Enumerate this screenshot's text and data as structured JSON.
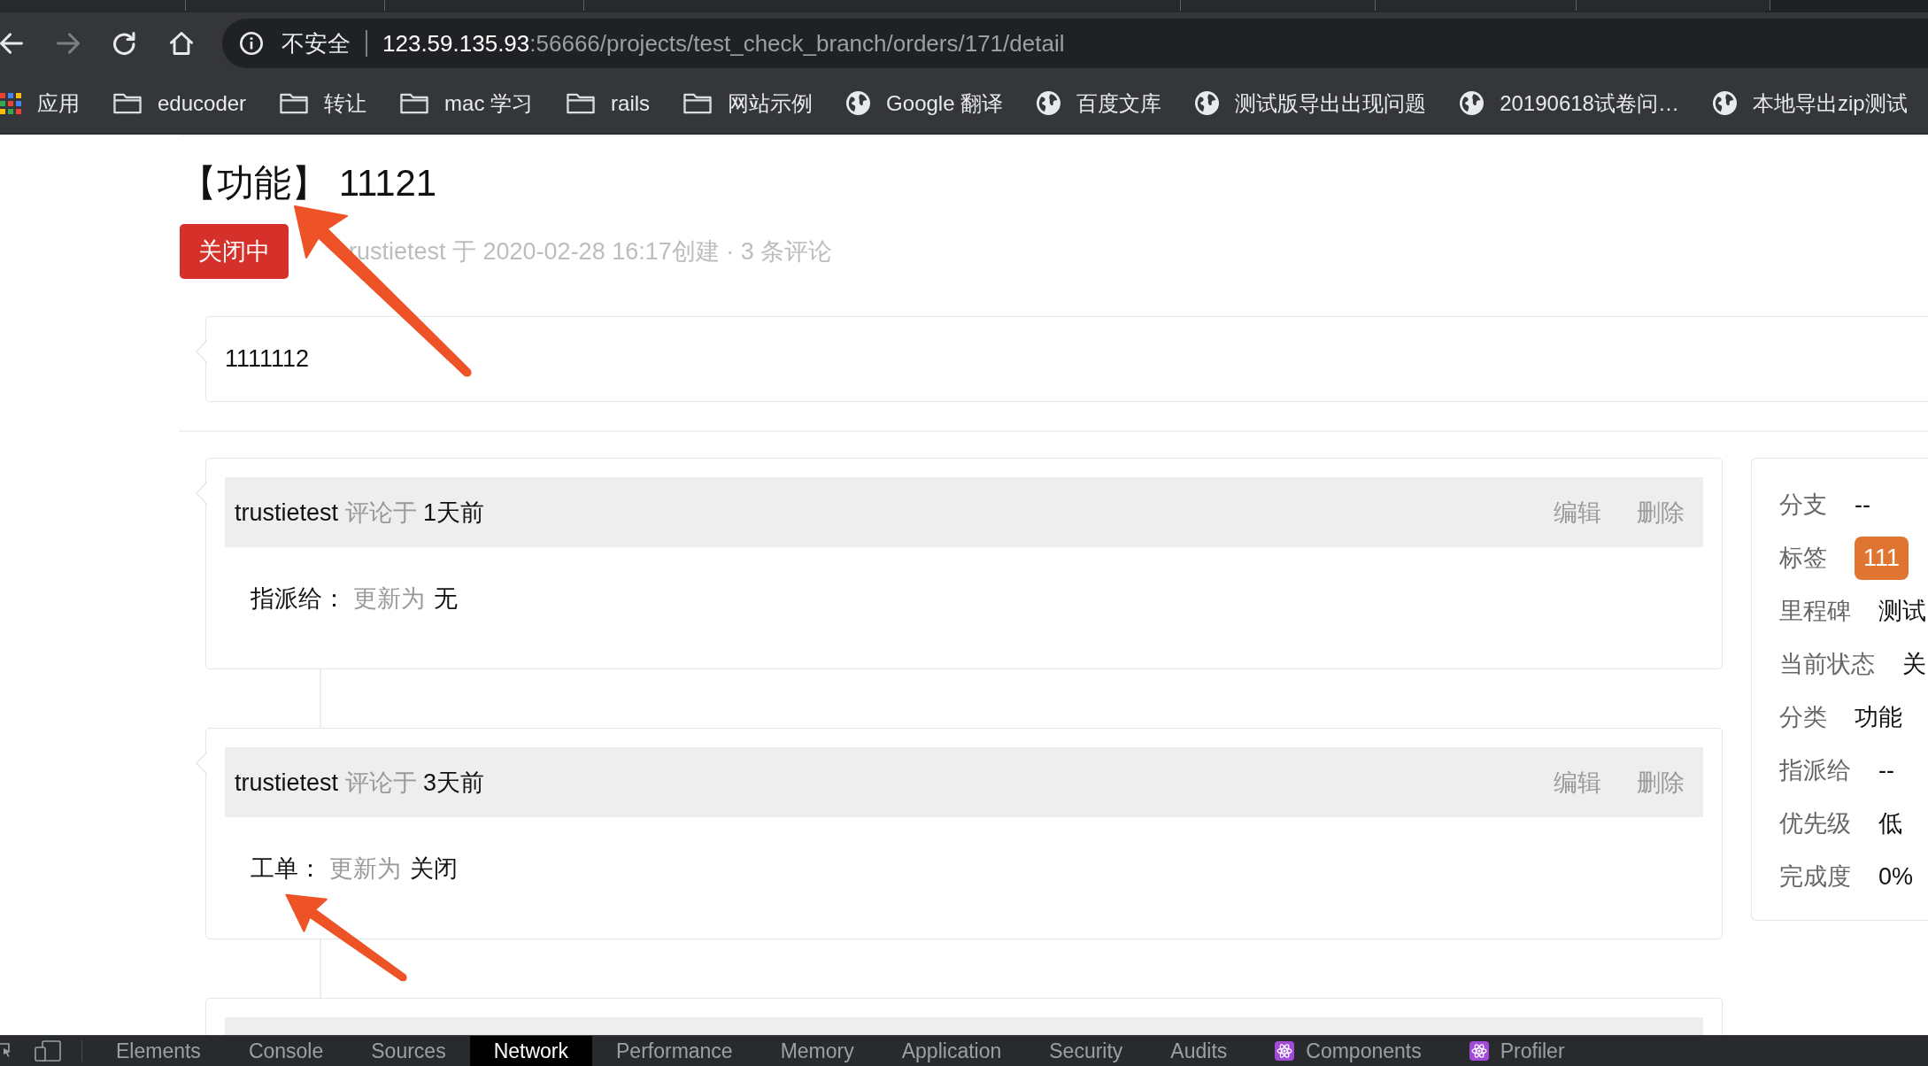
{
  "browser": {
    "nav_buttons": [
      {
        "kind": "back",
        "disabled": false
      },
      {
        "kind": "forward",
        "disabled": true
      },
      {
        "kind": "reload",
        "disabled": false
      },
      {
        "kind": "home",
        "disabled": false
      }
    ],
    "address_bar": {
      "security_label": "不安全",
      "host": "123.59.135.93",
      "path": ":56666/projects/test_check_branch/orders/171/detail"
    },
    "bookmarks": [
      {
        "kind": "apps",
        "label": "应用"
      },
      {
        "kind": "folder",
        "label": "educoder"
      },
      {
        "kind": "folder",
        "label": "转让"
      },
      {
        "kind": "folder",
        "label": "mac 学习"
      },
      {
        "kind": "folder",
        "label": "rails"
      },
      {
        "kind": "folder",
        "label": "网站示例"
      },
      {
        "kind": "page",
        "label": "Google 翻译"
      },
      {
        "kind": "page",
        "label": "百度文库"
      },
      {
        "kind": "page",
        "label": "测试版导出出现问题"
      },
      {
        "kind": "page",
        "label": "20190618试卷问…"
      },
      {
        "kind": "page",
        "label": "本地导出zip测试"
      }
    ]
  },
  "order": {
    "title": "【功能】 11121",
    "marked_by_arrow": true,
    "status": "关闭中",
    "meta": "rustietest 于 2020-02-28 16:17创建 · 3 条评论",
    "description": "1111112"
  },
  "comments": [
    {
      "kind": "update",
      "author": "trustietest",
      "action": "评论于",
      "time": "1天前",
      "actions": [
        "编辑",
        "删除"
      ],
      "field": "指派给：",
      "change": "更新为",
      "new_value": "无",
      "marked_by_arrow": false
    },
    {
      "kind": "update",
      "author": "trustietest",
      "action": "评论于",
      "time": "3天前",
      "actions": [
        "编辑",
        "删除"
      ],
      "field": "工单：",
      "change": "更新为",
      "new_value": "关闭",
      "marked_by_arrow": true
    },
    {
      "kind": "clipped"
    }
  ],
  "details": [
    {
      "kind": "text",
      "label": "分支",
      "value": "--"
    },
    {
      "kind": "tag",
      "label": "标签",
      "value": "111",
      "color": "#e07532"
    },
    {
      "kind": "text",
      "label": "里程碑",
      "value": "测试"
    },
    {
      "kind": "text",
      "label": "当前状态",
      "value": "关"
    },
    {
      "kind": "text",
      "label": "分类",
      "value": "功能"
    },
    {
      "kind": "text",
      "label": "指派给",
      "value": "--"
    },
    {
      "kind": "text",
      "label": "优先级",
      "value": "低"
    },
    {
      "kind": "text",
      "label": "完成度",
      "value": "0%"
    }
  ],
  "devtools": {
    "tabs": [
      {
        "kind": "builtin",
        "label": "Elements",
        "selected": false
      },
      {
        "kind": "builtin",
        "label": "Console",
        "selected": false
      },
      {
        "kind": "builtin",
        "label": "Sources",
        "selected": false
      },
      {
        "kind": "builtin",
        "label": "Network",
        "selected": true
      },
      {
        "kind": "builtin",
        "label": "Performance",
        "selected": false
      },
      {
        "kind": "builtin",
        "label": "Memory",
        "selected": false
      },
      {
        "kind": "builtin",
        "label": "Application",
        "selected": false
      },
      {
        "kind": "builtin",
        "label": "Security",
        "selected": false
      },
      {
        "kind": "builtin",
        "label": "Audits",
        "selected": false
      },
      {
        "kind": "extension",
        "label": "Components",
        "selected": false
      },
      {
        "kind": "extension",
        "label": "Profiler",
        "selected": false
      }
    ]
  }
}
